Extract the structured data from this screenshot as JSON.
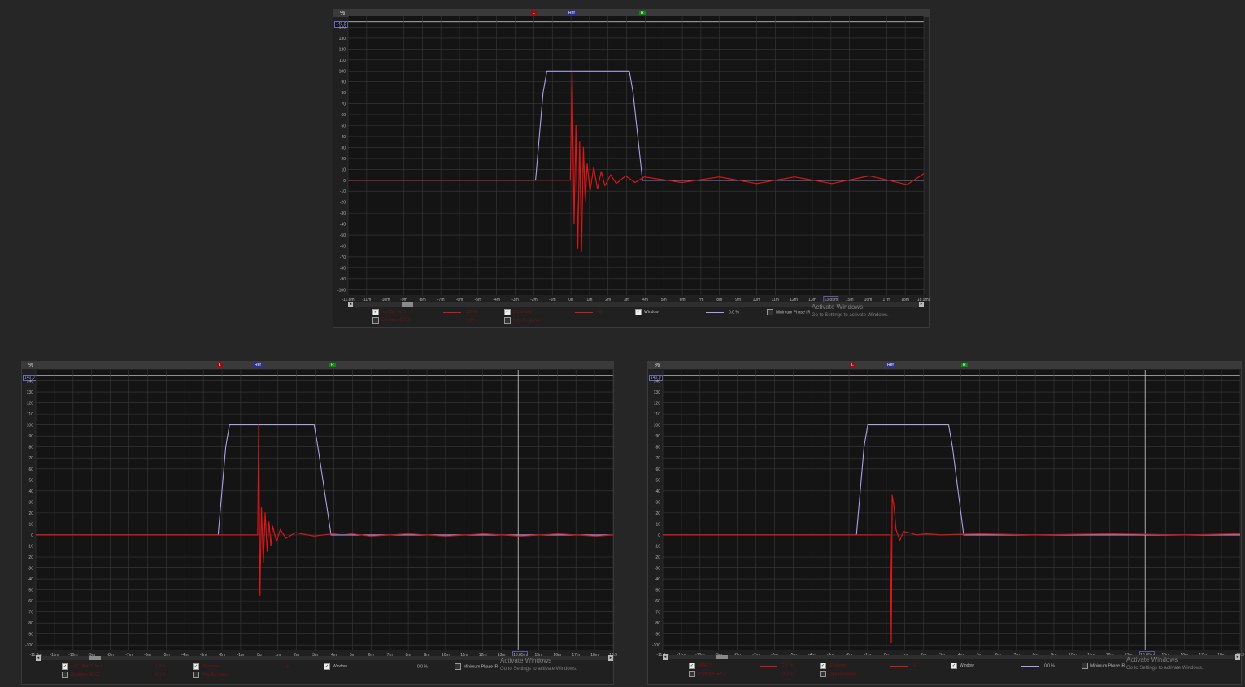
{
  "colors": {
    "window_trace": "#a9a3e6",
    "ir_trace": "#d81818",
    "grid": "#3a3a3a",
    "axis_text": "#b5b5b5",
    "cursor": "#cfcfcf"
  },
  "icons": [
    "zoom-in-icon",
    "zoom-out-icon",
    "checkbox-icon",
    "scroll-left-arrow-icon",
    "scroll-right-arrow-icon"
  ],
  "top_markers": {
    "left": "L",
    "ref": "Ref",
    "right": "R"
  },
  "y_unit": "%",
  "cursor_value": "140.0",
  "panels": [
    {
      "id": "top",
      "x_ticks": [
        "-11.8m",
        "-11m",
        "-10m",
        "-9m",
        "-8m",
        "-7m",
        "-6m",
        "-5m",
        "-4m",
        "-3m",
        "-2m",
        "-1m",
        "0u",
        "1m",
        "2m",
        "3m",
        "4m",
        "5m",
        "6m",
        "7m",
        "8m",
        "9m",
        "10m",
        "11m",
        "12m",
        "13m",
        "13.85m",
        "15m",
        "16m",
        "17m",
        "18m",
        "18.9ms"
      ],
      "legend": {
        "row1": [
          {
            "checked": true,
            "name": "mu-25p Ver 5",
            "value": "1.0 %"
          },
          {
            "checked": true,
            "name": "Windowed",
            "value": "%"
          },
          {
            "checked": true,
            "name": "Window",
            "value": "0.0 %"
          },
          {
            "checked": false,
            "name": "Minimum Phase IR",
            "value": ""
          }
        ],
        "row2": [
          {
            "checked": false,
            "name": "Envelope (ETC)",
            "value": "0.0 %"
          },
          {
            "checked": false,
            "name": "Step Response",
            "value": ""
          }
        ]
      },
      "select_value": "%",
      "watermark": {
        "title": "Activate Windows",
        "subtitle": "Go to Settings to activate Windows."
      }
    },
    {
      "id": "bottom-left",
      "x_ticks": [
        "-11.8m",
        "-11m",
        "-10m",
        "-9m",
        "-8m",
        "-7m",
        "-6m",
        "-5m",
        "-4m",
        "-3m",
        "-2m",
        "-1m",
        "0u",
        "1m",
        "2m",
        "3m",
        "4m",
        "5m",
        "6m",
        "7m",
        "8m",
        "9m",
        "10m",
        "11m",
        "12m",
        "13m",
        "13.85m",
        "15m",
        "16m",
        "17m",
        "18m",
        "18.9"
      ],
      "legend": {
        "row1": [
          {
            "checked": true,
            "name": "w-FC38xR3 Ver 6",
            "value": "1.0 %"
          },
          {
            "checked": true,
            "name": "Windowed",
            "value": "%"
          },
          {
            "checked": true,
            "name": "Window",
            "value": "0.0 %"
          },
          {
            "checked": false,
            "name": "Minimum Phase IR",
            "value": ""
          }
        ],
        "row2": [
          {
            "checked": false,
            "name": "Envelope (ETC)",
            "value": "0.0 %"
          },
          {
            "checked": false,
            "name": "Step Response",
            "value": ""
          }
        ]
      },
      "watermark": {
        "title": "Activate Windows",
        "subtitle": "Go to Settings to activate Windows."
      }
    },
    {
      "id": "bottom-right",
      "x_ticks": [
        "-11.8m",
        "-11m",
        "-10m",
        "-9m",
        "-8m",
        "-7m",
        "-6m",
        "-5m",
        "-4m",
        "-3m",
        "-2m",
        "-1m",
        "0u",
        "1m",
        "2m",
        "3m",
        "4m",
        "5m",
        "6m",
        "7m",
        "8m",
        "9m",
        "10m",
        "11m",
        "12m",
        "13m",
        "13.85m",
        "15m",
        "16m",
        "17m",
        "18m",
        "18.9"
      ],
      "legend": {
        "row1": [
          {
            "checked": true,
            "name": "s6040 5",
            "value": "2.5 %"
          },
          {
            "checked": true,
            "name": "Windowed",
            "value": "%"
          },
          {
            "checked": true,
            "name": "Window",
            "value": "0.0 %"
          },
          {
            "checked": false,
            "name": "Minimum Phase IR",
            "value": ""
          }
        ],
        "row2": [
          {
            "checked": false,
            "name": "Envelope (ETC)",
            "value": "0.0 %"
          },
          {
            "checked": false,
            "name": "Step Response",
            "value": ""
          }
        ]
      },
      "watermark": {
        "title": "Activate Windows",
        "subtitle": "Go to Settings to activate Windows."
      }
    }
  ],
  "chart_data": [
    {
      "type": "line",
      "title": "",
      "xlabel": "",
      "ylabel": "%",
      "xlim": [
        -11.8,
        18.9
      ],
      "ylim": [
        -105,
        150
      ],
      "y_ticks": [
        140,
        130,
        120,
        110,
        100,
        90,
        80,
        70,
        60,
        50,
        40,
        30,
        20,
        10,
        0,
        -10,
        -20,
        -30,
        -40,
        -50,
        -60,
        -70,
        -80,
        -90,
        -100
      ],
      "grid": true,
      "cursor_x": 13.85,
      "series": [
        {
          "name": "Window",
          "color": "#a9a3e6",
          "x": [
            -11.8,
            -1.8,
            -1.4,
            -1.2,
            3.2,
            3.4,
            3.9,
            18.9
          ],
          "y": [
            0,
            0,
            80,
            100,
            100,
            80,
            0,
            0
          ]
        },
        {
          "name": "mu-25p Ver 5",
          "color": "#d81818",
          "x": [
            -11.8,
            0.05,
            0.15,
            0.25,
            0.35,
            0.45,
            0.55,
            0.65,
            0.75,
            0.85,
            0.95,
            1.1,
            1.3,
            1.5,
            1.7,
            1.9,
            2.2,
            2.5,
            3.0,
            3.5,
            4.0,
            6,
            8,
            10,
            12,
            14,
            16,
            18,
            18.9
          ],
          "y": [
            0,
            0,
            100,
            -40,
            50,
            -62,
            35,
            -65,
            30,
            -20,
            15,
            -10,
            12,
            -8,
            8,
            -5,
            5,
            -3,
            4,
            -2,
            3,
            -2,
            3,
            -3,
            3,
            -3,
            4,
            -4,
            6
          ]
        }
      ]
    },
    {
      "type": "line",
      "title": "",
      "xlabel": "",
      "ylabel": "%",
      "xlim": [
        -11.8,
        18.9
      ],
      "ylim": [
        -105,
        150
      ],
      "y_ticks": [
        140,
        130,
        120,
        110,
        100,
        90,
        80,
        70,
        60,
        50,
        40,
        30,
        20,
        10,
        0,
        -10,
        -20,
        -30,
        -40,
        -50,
        -60,
        -70,
        -80,
        -90,
        -100
      ],
      "grid": true,
      "cursor_x": 13.85,
      "series": [
        {
          "name": "Window",
          "color": "#a9a3e6",
          "x": [
            -11.8,
            -2.1,
            -1.7,
            -1.5,
            3.0,
            3.2,
            3.9,
            18.9
          ],
          "y": [
            0,
            0,
            80,
            100,
            100,
            80,
            0,
            0
          ]
        },
        {
          "name": "w-FC38xR3 Ver 6",
          "color": "#d81818",
          "x": [
            -11.8,
            0.0,
            0.05,
            0.12,
            0.2,
            0.3,
            0.4,
            0.5,
            0.6,
            0.7,
            0.8,
            1.0,
            1.2,
            1.5,
            2.0,
            3.0,
            4.5,
            6,
            8,
            10,
            12,
            14,
            16,
            18,
            18.9
          ],
          "y": [
            0,
            0,
            100,
            -55,
            25,
            -25,
            20,
            -15,
            12,
            -10,
            8,
            -6,
            5,
            -3,
            2,
            -1,
            2,
            -1,
            1,
            -1,
            1,
            -1,
            1,
            -1,
            0
          ]
        }
      ]
    },
    {
      "type": "line",
      "title": "",
      "xlabel": "",
      "ylabel": "%",
      "xlim": [
        -11.8,
        18.9
      ],
      "ylim": [
        -105,
        150
      ],
      "y_ticks": [
        140,
        130,
        120,
        110,
        100,
        90,
        80,
        70,
        60,
        50,
        40,
        30,
        20,
        10,
        0,
        -10,
        -20,
        -30,
        -40,
        -50,
        -60,
        -70,
        -80,
        -90,
        -100
      ],
      "grid": true,
      "cursor_x": 13.85,
      "series": [
        {
          "name": "Window",
          "color": "#a9a3e6",
          "x": [
            -11.8,
            -1.5,
            -1.1,
            -0.9,
            3.4,
            3.6,
            4.2,
            18.9
          ],
          "y": [
            0,
            0,
            80,
            100,
            100,
            80,
            0,
            0
          ]
        },
        {
          "name": "s6040 5",
          "color": "#d81818",
          "x": [
            -11.8,
            0.3,
            0.35,
            0.4,
            0.5,
            0.6,
            0.8,
            1.0,
            1.3,
            1.7,
            2.2,
            3,
            5,
            8,
            12,
            16,
            18.9
          ],
          "y": [
            0,
            0,
            -98,
            36,
            25,
            5,
            -5,
            3,
            2,
            0,
            1,
            0,
            1,
            0,
            1,
            0,
            1
          ]
        }
      ]
    }
  ]
}
